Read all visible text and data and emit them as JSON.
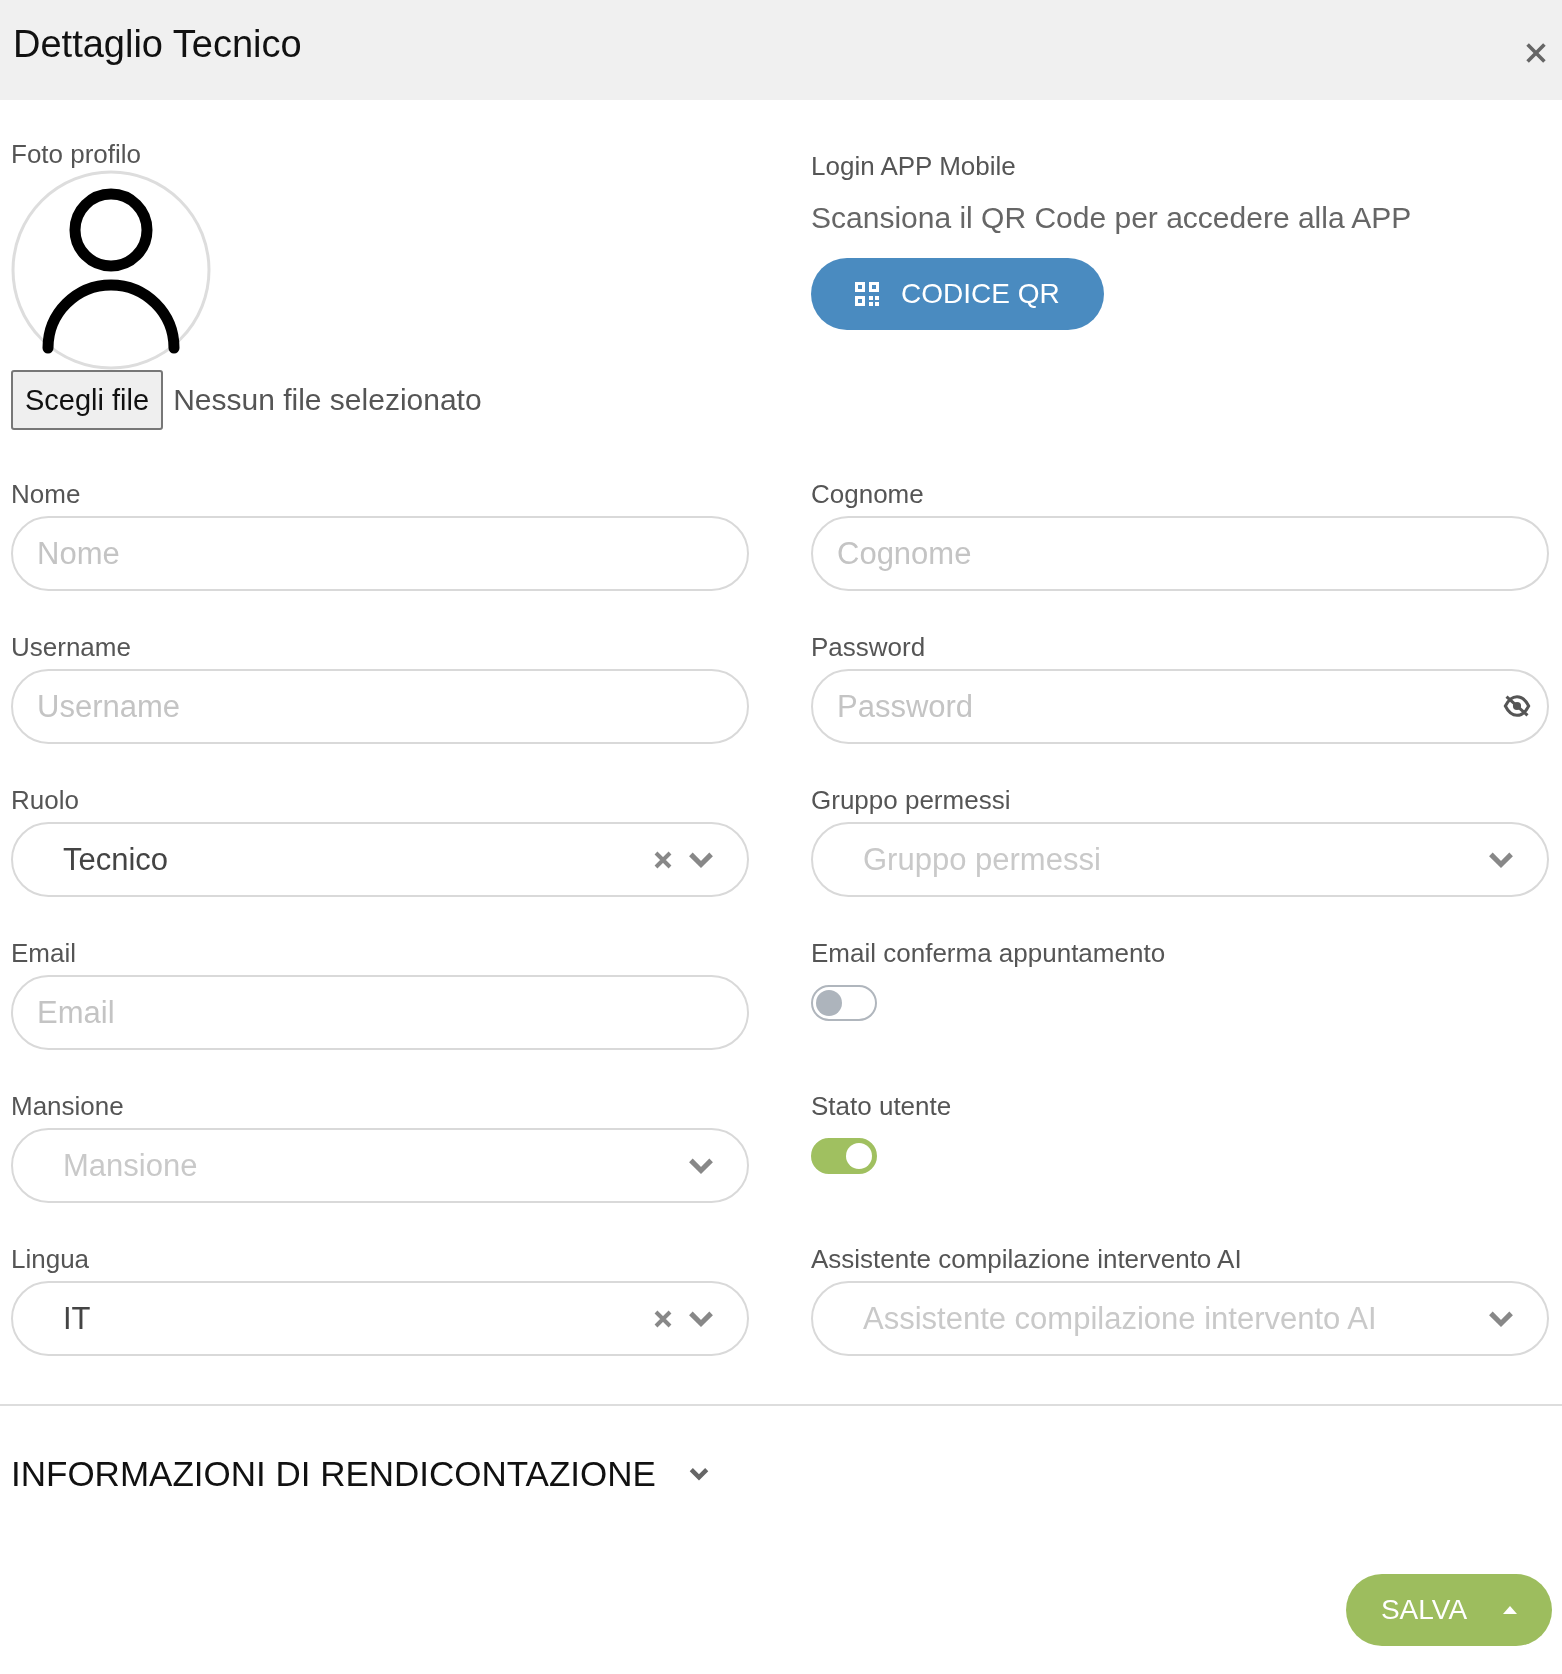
{
  "window": {
    "title": "Dettaglio Tecnico"
  },
  "photo": {
    "label": "Foto profilo",
    "file_button": "Scegli file",
    "file_status": "Nessun file selezionato"
  },
  "login": {
    "title": "Login APP Mobile",
    "text": "Scansiona il QR Code per accedere alla APP",
    "button": "CODICE QR"
  },
  "fields": [
    {
      "label": "Nome",
      "kind": "text",
      "placeholder": "Nome"
    },
    {
      "label": "Cognome",
      "kind": "text",
      "placeholder": "Cognome"
    },
    {
      "label": "Username",
      "kind": "text",
      "placeholder": "Username"
    },
    {
      "label": "Password",
      "kind": "password",
      "placeholder": "Password"
    },
    {
      "label": "Ruolo",
      "kind": "select",
      "value": "Tecnico",
      "clearable": true
    },
    {
      "label": "Gruppo permessi",
      "kind": "select",
      "placeholder": "Gruppo permessi",
      "clearable": false
    },
    {
      "label": "Email",
      "kind": "text",
      "placeholder": "Email"
    },
    {
      "label": "Email conferma appuntamento",
      "kind": "toggle",
      "on": false
    },
    {
      "label": "Mansione",
      "kind": "select",
      "placeholder": "Mansione",
      "clearable": false
    },
    {
      "label": "Stato utente",
      "kind": "toggle",
      "on": true
    },
    {
      "label": "Lingua",
      "kind": "select",
      "value": "IT",
      "clearable": true
    },
    {
      "label": "Assistente compilazione intervento AI",
      "kind": "select",
      "placeholder": "Assistente compilazione intervento AI",
      "clearable": false
    }
  ],
  "section": {
    "title": "INFORMAZIONI DI RENDICONTAZIONE",
    "expanded": false
  },
  "save_button": "SALVA"
}
